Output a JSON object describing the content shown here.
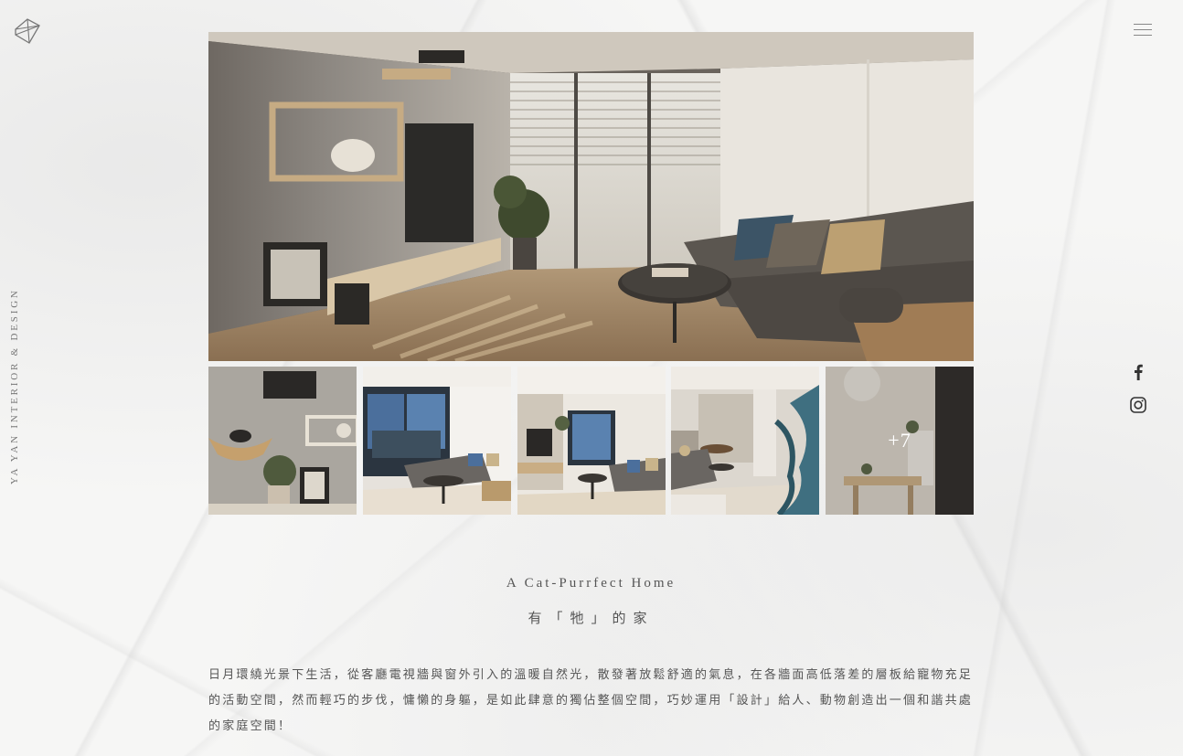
{
  "brand": {
    "vertical_text": "YA YAN INTERIOR & DESIGN",
    "logo_icon": "diamond-logo-icon"
  },
  "header": {
    "menu_icon": "hamburger-menu-icon"
  },
  "social": {
    "items": [
      {
        "name": "facebook",
        "icon": "facebook-icon",
        "glyph": "f"
      },
      {
        "name": "instagram",
        "icon": "instagram-icon"
      }
    ]
  },
  "gallery": {
    "more_label": "+7",
    "photos": [
      "living-room-main",
      "cat-shelf-wall",
      "window-sofa",
      "tv-wall-sofa",
      "dining-area",
      "dining-table"
    ]
  },
  "project": {
    "title_en": "A Cat-Purrfect Home",
    "title_zh": "有「牠」的家",
    "description": "日月環繞光景下生活，從客廳電視牆與窗外引入的溫暖自然光，散發著放鬆舒適的氣息，在各牆面高低落差的層板給寵物充足的活動空間，然而輕巧的步伐，慵懶的身軀，是如此肆意的獨佔整個空間，巧妙運用「設計」給人、動物創造出一個和諧共處的家庭空間！"
  },
  "colors": {
    "text": "#555555",
    "background": "#f6f6f5",
    "accent_wood": "#b08a62"
  }
}
